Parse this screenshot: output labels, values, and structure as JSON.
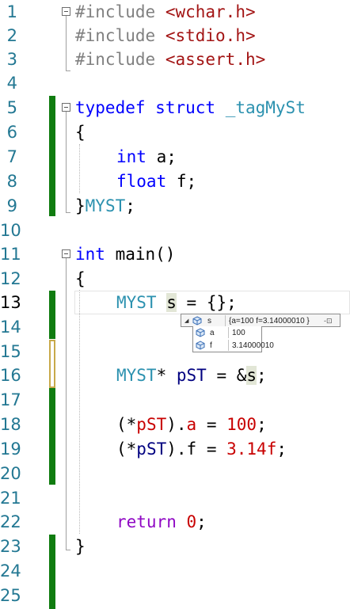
{
  "line_numbers": [
    "1",
    "2",
    "3",
    "4",
    "5",
    "6",
    "7",
    "8",
    "9",
    "10",
    "11",
    "12",
    "13",
    "14",
    "15",
    "16",
    "17",
    "18",
    "19",
    "20",
    "21",
    "22",
    "23",
    "24",
    "25"
  ],
  "current_line": "13",
  "code": {
    "l1": {
      "directive": "#include",
      "file": "<wchar.h>"
    },
    "l2": {
      "directive": "#include",
      "file": "<stdio.h>"
    },
    "l3": {
      "directive": "#include",
      "file": "<assert.h>"
    },
    "l5": {
      "kw_typedef": "typedef",
      "kw_struct": "struct",
      "name": "_tagMySt"
    },
    "l6": {
      "text": "{"
    },
    "l7": {
      "type": "int",
      "rest": " a;"
    },
    "l8": {
      "type": "float",
      "rest": " f;"
    },
    "l9": {
      "brace": "}",
      "alias": "MYST",
      "semi": ";"
    },
    "l11": {
      "type": "int",
      "rest": " main()"
    },
    "l12": {
      "text": "{"
    },
    "l13": {
      "type": "MYST",
      "sp": " ",
      "var": "s",
      "rest": " = {};"
    },
    "l16": {
      "type": "MYST",
      "star": "* ",
      "var": "pST",
      "mid": " = &",
      "ref": "s",
      "end": ";"
    },
    "l18": {
      "open": "(*",
      "var": "pST",
      "mid": ").",
      "field": "a",
      "eq": " = ",
      "num": "100",
      "end": ";"
    },
    "l19": {
      "open": "(*",
      "var": "pST",
      "mid": ").",
      "field": "f",
      "eq": " = ",
      "num": "3.14f",
      "end": ";"
    },
    "l22": {
      "kw": "return",
      "sp": " ",
      "num": "0",
      "end": ";"
    },
    "l23": {
      "text": "}"
    }
  },
  "datatip": {
    "root": {
      "name": "s",
      "value": "{a=100 f=3.14000010 }"
    },
    "children": [
      {
        "name": "a",
        "value": "100"
      },
      {
        "name": "f",
        "value": "3.14000010"
      }
    ],
    "expand_glyph": "◢",
    "pin_glyph": "-⊡"
  },
  "colors": {
    "keyword": "#0000ff",
    "preprocessor": "#808080",
    "string": "#a31515",
    "type": "#2b91af",
    "number": "#c80000",
    "control_keyword": "#8f08c4",
    "change_bar_saved": "#107c10",
    "change_bar_unsaved": "#c8a94a"
  },
  "icons": {
    "datatip_object": "object-variable-icon",
    "datatip_pin": "pin-icon"
  }
}
